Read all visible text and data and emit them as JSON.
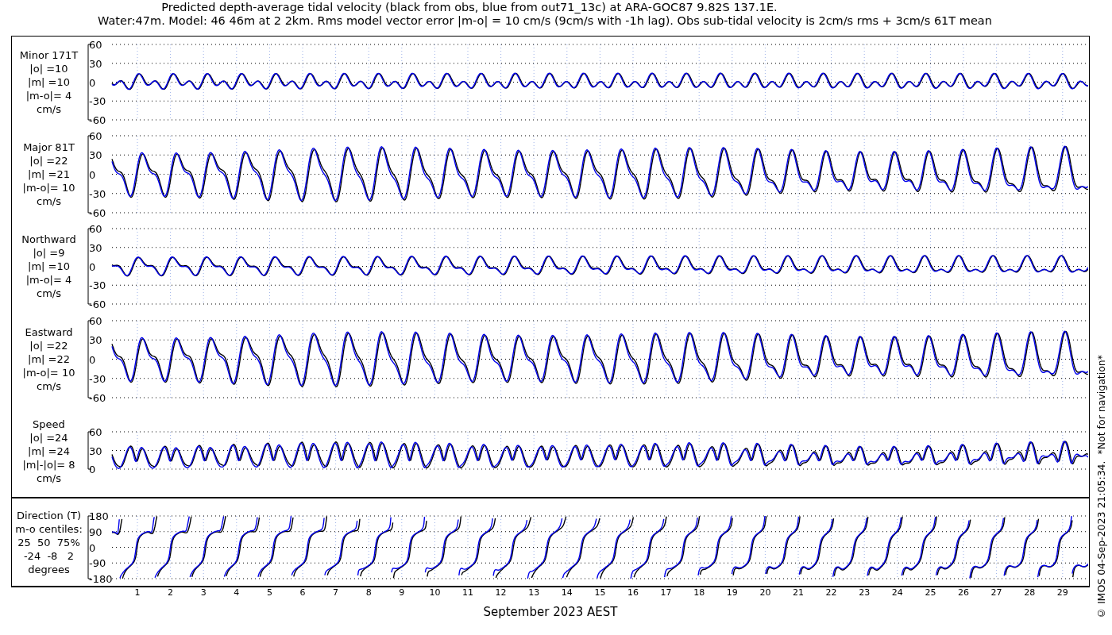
{
  "title_lines": [
    "Predicted depth-average tidal velocity (black from obs, blue from out71_13c) at ARA-GOC87 9.82S 137.1E.",
    "Water:47m. Model: 46 46m at 2 2km. Rms model vector error |m-o| = 10 cm/s (9cm/s with -1h lag). Obs sub-tidal velocity is 2cm/s rms + 3cm/s 61T mean"
  ],
  "panels": [
    {
      "kind": "minor",
      "label_lines": [
        "Minor 171T",
        "|o| =10",
        "|m| =10",
        "|m-o|= 4",
        "cm/s"
      ],
      "tick_labels": [
        "60",
        "30",
        "0",
        "-30",
        "-60"
      ]
    },
    {
      "kind": "major",
      "label_lines": [
        "Major 81T",
        "|o| =22",
        "|m| =21",
        "|m-o|= 10",
        "cm/s"
      ],
      "tick_labels": [
        "60",
        "30",
        "0",
        "-30",
        "-60"
      ]
    },
    {
      "kind": "north",
      "label_lines": [
        "Northward",
        "|o| =9",
        "|m| =10",
        "|m-o|= 4",
        "cm/s"
      ],
      "tick_labels": [
        "60",
        "30",
        "0",
        "-30",
        "-60"
      ]
    },
    {
      "kind": "east",
      "label_lines": [
        "Eastward",
        "|o| =22",
        "|m| =22",
        "|m-o|= 10",
        "cm/s"
      ],
      "tick_labels": [
        "60",
        "30",
        "0",
        "-30",
        "-60"
      ]
    },
    {
      "kind": "speed",
      "label_lines": [
        "Speed",
        "|o| =24",
        "|m| =24",
        "|m|-|o|= 8",
        "cm/s"
      ],
      "tick_labels": [
        "60",
        "30",
        "0"
      ]
    },
    {
      "kind": "direction",
      "label_lines": [
        "Direction (T)",
        "m-o centiles:",
        "25  50  75%",
        "-24  -8   2",
        "degrees"
      ],
      "tick_labels": [
        "180",
        "90",
        "0",
        "-90",
        "-180"
      ]
    }
  ],
  "x_axis": {
    "day_labels": [
      "1",
      "2",
      "3",
      "4",
      "5",
      "6",
      "7",
      "8",
      "9",
      "10",
      "11",
      "12",
      "13",
      "14",
      "15",
      "16",
      "17",
      "18",
      "19",
      "20",
      "21",
      "22",
      "23",
      "24",
      "25",
      "26",
      "27",
      "28",
      "29"
    ],
    "label": "September 2023 AEST"
  },
  "credit": "© IMOS 04-Sep-2023 21:05:34.  *Not for navigation*"
}
